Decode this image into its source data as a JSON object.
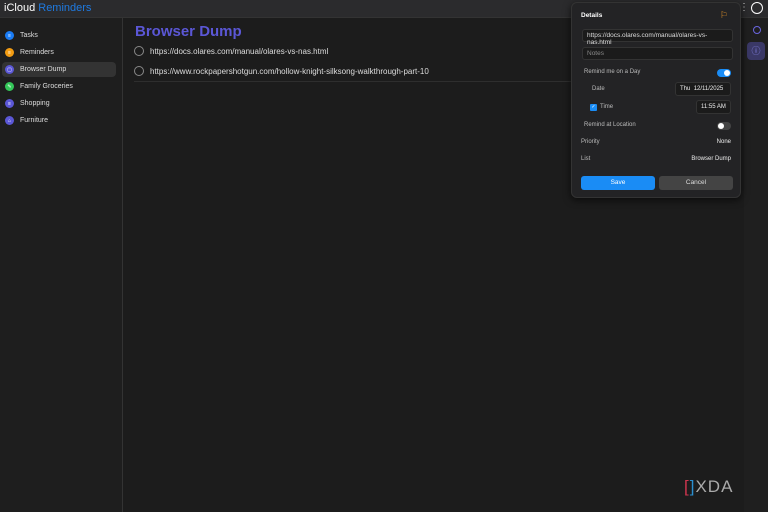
{
  "app": {
    "icloud": "iCloud",
    "reminders": "Reminders"
  },
  "sidebar": {
    "items": [
      {
        "label": "Tasks",
        "color": "#1a7cf5"
      },
      {
        "label": "Reminders",
        "color": "#f39c12"
      },
      {
        "label": "Browser Dump",
        "color": "#5b57d6",
        "active": true
      },
      {
        "label": "Family Groceries",
        "color": "#34c759"
      },
      {
        "label": "Shopping",
        "color": "#5b57d6"
      },
      {
        "label": "Furniture",
        "color": "#5b57d6"
      }
    ]
  },
  "main": {
    "title": "Browser Dump",
    "items": [
      "https://docs.olares.com/manual/olares-vs-nas.html",
      "https://www.rockpapershotgun.com/hollow-knight-silksong-walkthrough-part-10"
    ]
  },
  "details": {
    "heading": "Details",
    "url": "https://docs.olares.com/manual/olares-vs-nas.html",
    "notes_placeholder": "Notes",
    "remind_day": "Remind me on a Day",
    "remind_day_on": true,
    "date_label": "Date",
    "date_day": "Thu",
    "date_value": "12/11/2025",
    "time_label": "Time",
    "time_checked": true,
    "time_value": "11:55 AM",
    "remind_location": "Remind at Location",
    "remind_location_on": false,
    "priority_label": "Priority",
    "priority_value": "None",
    "list_label": "List",
    "list_value": "Browser Dump",
    "save": "Save",
    "cancel": "Cancel"
  },
  "watermark": "XDA"
}
